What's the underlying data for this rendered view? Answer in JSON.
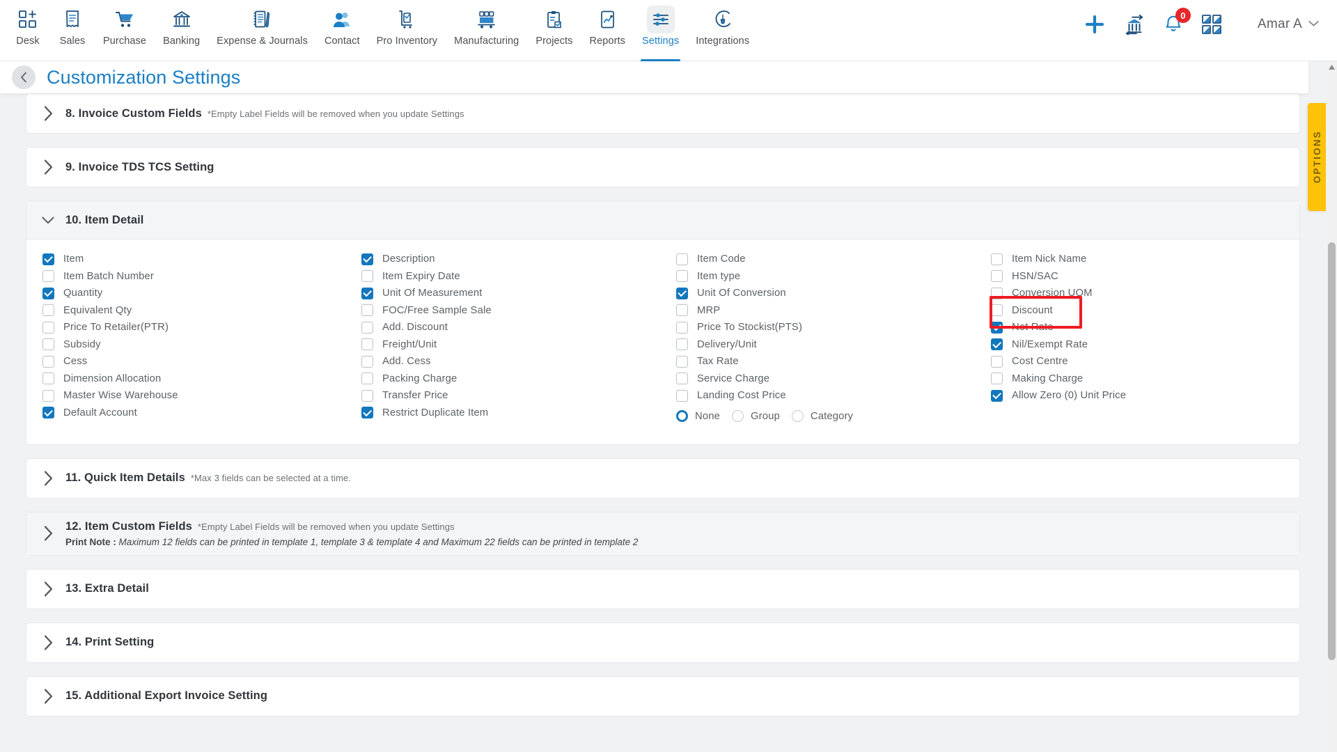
{
  "colors": {
    "accent": "#1b7fc4",
    "checkbox_on": "#1277bd",
    "badge_red": "#e8262b",
    "annotation_red": "#ee1b24",
    "options_tab": "#fdc20a",
    "page_bg": "#f1f2f4"
  },
  "topnav": {
    "items": [
      {
        "label": "Desk",
        "icon": "dashboard-add-icon",
        "active": false
      },
      {
        "label": "Sales",
        "icon": "receipt-icon",
        "active": false
      },
      {
        "label": "Purchase",
        "icon": "shopping-cart-icon",
        "active": false
      },
      {
        "label": "Banking",
        "icon": "bank-icon",
        "active": false
      },
      {
        "label": "Expense & Journals",
        "icon": "notebook-pen-icon",
        "active": false
      },
      {
        "label": "Contact",
        "icon": "people-icon",
        "active": false
      },
      {
        "label": "Pro Inventory",
        "icon": "inventory-cart-icon",
        "active": false
      },
      {
        "label": "Manufacturing",
        "icon": "manufacturing-icon",
        "active": false
      },
      {
        "label": "Projects",
        "icon": "clipboard-icon",
        "active": false
      },
      {
        "label": "Reports",
        "icon": "report-chart-icon",
        "active": false
      },
      {
        "label": "Settings",
        "icon": "sliders-icon",
        "active": true
      },
      {
        "label": "Integrations",
        "icon": "plug-icon",
        "active": false
      }
    ],
    "actions": {
      "add": "add-icon",
      "bank_transfer": "bank-transfer-icon",
      "notifications": "bell-icon",
      "notification_count": "0",
      "apps": "apps-grid-icon"
    },
    "user": {
      "name": "Amar A",
      "caret": "chevron-down-icon"
    }
  },
  "header": {
    "back": "back-chevron-icon",
    "title": "Customization Settings"
  },
  "sections": [
    {
      "id": "sec8",
      "title": "8. Invoice Custom Fields",
      "note": "*Empty Label Fields will be removed when you update Settings",
      "expanded": false,
      "gray": false
    },
    {
      "id": "sec9",
      "title": "9. Invoice TDS TCS Setting",
      "note": "",
      "expanded": false,
      "gray": false
    },
    {
      "id": "sec10",
      "title": "10. Item Detail",
      "note": "",
      "expanded": true,
      "gray": true
    },
    {
      "id": "sec11",
      "title": "11. Quick Item Details",
      "note": "*Max 3 fields can be selected at a time.",
      "expanded": false,
      "gray": false
    },
    {
      "id": "sec12",
      "title": "12. Item Custom Fields",
      "note": "*Empty Label Fields will be removed when you update Settings",
      "print_note_label": "Print Note :",
      "print_note_text": " Maximum 12 fields can be printed in template 1, template 3 & template 4 and Maximum 22 fields can be printed in template 2",
      "expanded": false,
      "gray": true
    },
    {
      "id": "sec13",
      "title": "13. Extra Detail",
      "note": "",
      "expanded": false,
      "gray": false
    },
    {
      "id": "sec14",
      "title": "14. Print Setting",
      "note": "",
      "expanded": false,
      "gray": false
    },
    {
      "id": "sec15",
      "title": "15. Additional Export Invoice Setting",
      "note": "",
      "expanded": false,
      "gray": false
    }
  ],
  "item_detail": {
    "columns": [
      {
        "options": [
          {
            "label": "Item",
            "checked": true
          },
          {
            "label": "Item Batch Number",
            "checked": false
          },
          {
            "label": "Quantity",
            "checked": true
          },
          {
            "label": "Equivalent Qty",
            "checked": false
          },
          {
            "label": "Price To Retailer(PTR)",
            "checked": false
          },
          {
            "label": "Subsidy",
            "checked": false
          },
          {
            "label": "Cess",
            "checked": false
          },
          {
            "label": "Dimension Allocation",
            "checked": false
          },
          {
            "label": "Master Wise Warehouse",
            "checked": false
          },
          {
            "label": "Default Account",
            "checked": true
          }
        ]
      },
      {
        "options": [
          {
            "label": "Description",
            "checked": true
          },
          {
            "label": "Item Expiry Date",
            "checked": false
          },
          {
            "label": "Unit Of Measurement",
            "checked": true
          },
          {
            "label": "FOC/Free Sample Sale",
            "checked": false
          },
          {
            "label": "Add. Discount",
            "checked": false
          },
          {
            "label": "Freight/Unit",
            "checked": false
          },
          {
            "label": "Add. Cess",
            "checked": false
          },
          {
            "label": "Packing Charge",
            "checked": false
          },
          {
            "label": "Transfer Price",
            "checked": false
          },
          {
            "label": "Restrict Duplicate Item",
            "checked": true
          }
        ]
      },
      {
        "options": [
          {
            "label": "Item Code",
            "checked": false
          },
          {
            "label": "Item type",
            "checked": false
          },
          {
            "label": "Unit Of Conversion",
            "checked": true
          },
          {
            "label": "MRP",
            "checked": false
          },
          {
            "label": "Price To Stockist(PTS)",
            "checked": false
          },
          {
            "label": "Delivery/Unit",
            "checked": false
          },
          {
            "label": "Tax Rate",
            "checked": false
          },
          {
            "label": "Service Charge",
            "checked": false
          },
          {
            "label": "Landing Cost Price",
            "checked": false
          }
        ],
        "radios": {
          "selected": "None",
          "options": [
            "None",
            "Group",
            "Category"
          ]
        }
      },
      {
        "options": [
          {
            "label": "Item Nick Name",
            "checked": false
          },
          {
            "label": "HSN/SAC",
            "checked": false
          },
          {
            "label": "Conversion UOM",
            "checked": false
          },
          {
            "label": "Discount",
            "checked": false
          },
          {
            "label": "Net Rate",
            "checked": true,
            "highlighted": true
          },
          {
            "label": "Nil/Exempt Rate",
            "checked": true
          },
          {
            "label": "Cost Centre",
            "checked": false
          },
          {
            "label": "Making Charge",
            "checked": false
          },
          {
            "label": "Allow Zero (0) Unit Price",
            "checked": true
          }
        ]
      }
    ]
  },
  "options_tab": {
    "label": "OPTIONS"
  }
}
